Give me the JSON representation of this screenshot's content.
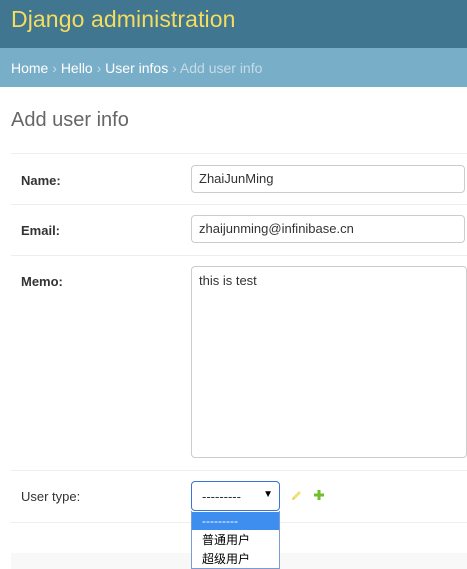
{
  "header": {
    "branding": "Django administration"
  },
  "breadcrumbs": {
    "items": [
      {
        "label": "Home"
      },
      {
        "label": "Hello"
      },
      {
        "label": "User infos"
      }
    ],
    "current": "Add user info",
    "separator": "›"
  },
  "page": {
    "title": "Add user info"
  },
  "form": {
    "name": {
      "label": "Name:",
      "value": "ZhaiJunMing"
    },
    "email": {
      "label": "Email:",
      "value": "zhaijunming@infinibase.cn"
    },
    "memo": {
      "label": "Memo:",
      "value": "this is test"
    },
    "user_type": {
      "label": "User type:",
      "selected": "---------",
      "options": [
        "---------",
        "普通用户",
        "超级用户"
      ]
    }
  },
  "icons": {
    "edit": "pencil-icon",
    "add": "plus-icon"
  },
  "colors": {
    "header_bg": "#417690",
    "branding": "#f5dd5d",
    "breadcrumbs_bg": "#79aec8",
    "select_highlight": "#3e8ef0",
    "add_icon": "#70bf2b"
  }
}
